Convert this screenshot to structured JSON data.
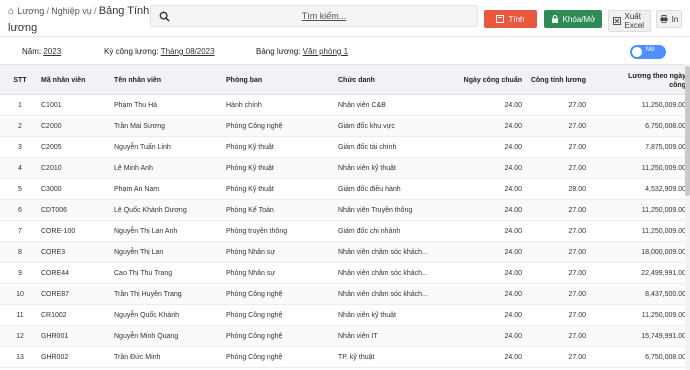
{
  "breadcrumb": {
    "home_glyph": "⌂",
    "items": [
      "Lương",
      "Nghiệp vụ"
    ],
    "separator": "/",
    "current": "Bảng Tính lương"
  },
  "search": {
    "placeholder": "Tìm kiếm..."
  },
  "toolbar": {
    "calc_label": "Tính",
    "lock_label": "Khóa/Mở",
    "export_label": "Xuất Excel",
    "print_label": "In",
    "calc_color": "#e9573f",
    "lock_color": "#2e8b57"
  },
  "filters": {
    "year_label": "Năm:",
    "year_value": "2023",
    "period_label": "Kỳ công lương:",
    "period_value": "Tháng 08/2023",
    "table_label": "Bảng lương:",
    "table_value": "Văn phòng 1"
  },
  "toggle": {
    "label": "Mở",
    "on": true,
    "color": "#4d90fe"
  },
  "table": {
    "columns": {
      "stt": "STT",
      "code": "Mã nhân viên",
      "name": "Tên nhân viên",
      "dept": "Phòng ban",
      "title": "Chức danh",
      "std_days": "Ngày công chuẩn",
      "work_days": "Công tính lương",
      "salary_line1": "Lương theo ngày",
      "salary_line2": "công"
    },
    "rows": [
      {
        "stt": "1",
        "code": "C1001",
        "name": "Phạm Thu Hà",
        "dept": "Hành chính",
        "title": "Nhân viên C&B",
        "std": "24.00",
        "work": "27.00",
        "salary": "11,250,009.00"
      },
      {
        "stt": "2",
        "code": "C2000",
        "name": "Trần Mai Sương",
        "dept": "Phòng Công nghệ",
        "title": "Giám đốc khu vực",
        "std": "24.00",
        "work": "27.00",
        "salary": "6,750,008.00"
      },
      {
        "stt": "3",
        "code": "C2005",
        "name": "Nguyễn Tuấn Linh",
        "dept": "Phòng Kỹ thuật",
        "title": "Giám đốc tài chính",
        "std": "24.00",
        "work": "27.00",
        "salary": "7,875,009.00"
      },
      {
        "stt": "4",
        "code": "C2010",
        "name": "Lê Minh Anh",
        "dept": "Phòng Kỹ thuật",
        "title": "Nhân viên kỹ thuật",
        "std": "24.00",
        "work": "27.00",
        "salary": "11,250,009.00"
      },
      {
        "stt": "5",
        "code": "C3000",
        "name": "Phạm An Nam",
        "dept": "Phòng Kỹ thuật",
        "title": "Giám đốc điều hành",
        "std": "24.00",
        "work": "28.00",
        "salary": "4,532,909.00"
      },
      {
        "stt": "6",
        "code": "CDT006",
        "name": "Lê Quốc Khánh Dương",
        "dept": "Phòng Kế Toán",
        "title": "Nhân viên Truyền thông",
        "std": "24.00",
        "work": "27.00",
        "salary": "11,250,009.00"
      },
      {
        "stt": "7",
        "code": "CORE-100",
        "name": "Nguyễn Thị Lan Anh",
        "dept": "Phòng truyền thông",
        "title": "Giám đốc chi nhánh",
        "std": "24.00",
        "work": "27.00",
        "salary": "11,250,009.00"
      },
      {
        "stt": "8",
        "code": "CORE3",
        "name": "Nguyễn Thị Lan",
        "dept": "Phòng Nhân sự",
        "title": "Nhân viên chăm sóc khách...",
        "std": "24.00",
        "work": "27.00",
        "salary": "18,000,009.00"
      },
      {
        "stt": "9",
        "code": "CORE44",
        "name": "Cao Thị Thu Trang",
        "dept": "Phòng Nhân sự",
        "title": "Nhân viên chăm sóc khách...",
        "std": "24.00",
        "work": "27.00",
        "salary": "22,499,991.00"
      },
      {
        "stt": "10",
        "code": "CORE87",
        "name": "Trần Thị Huyền Trang",
        "dept": "Phòng Công nghệ",
        "title": "Nhân viên chăm sóc khách...",
        "std": "24.00",
        "work": "27.00",
        "salary": "8,437,500.00"
      },
      {
        "stt": "11",
        "code": "CR1002",
        "name": "Nguyễn Quốc Khánh",
        "dept": "Phòng Công nghệ",
        "title": "Nhân viên kỹ thuật",
        "std": "24.00",
        "work": "27.00",
        "salary": "11,250,009.00"
      },
      {
        "stt": "12",
        "code": "GHR001",
        "name": "Nguyễn Minh Quang",
        "dept": "Phòng Công nghệ",
        "title": "Nhân viên IT",
        "std": "24.00",
        "work": "27.00",
        "salary": "15,749,991.00"
      },
      {
        "stt": "13",
        "code": "GHR002",
        "name": "Trần Đức Minh",
        "dept": "Phòng Công nghệ",
        "title": "TP. kỹ thuật",
        "std": "24.00",
        "work": "27.00",
        "salary": "6,750,008.00"
      }
    ]
  }
}
